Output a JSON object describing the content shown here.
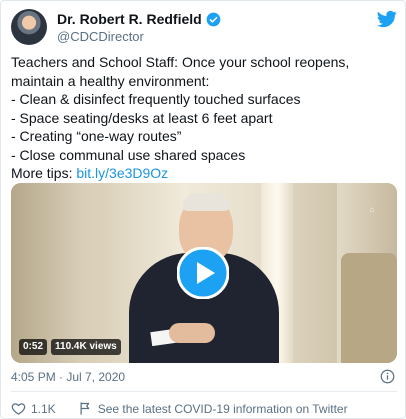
{
  "author": {
    "name": "Dr. Robert R. Redfield",
    "handle": "@CDCDirector"
  },
  "tweet": {
    "lines": [
      "Teachers and School Staff: Once your school reopens,",
      "maintain a healthy environment:",
      "- Clean & disinfect frequently touched surfaces",
      "- Space seating/desks at least 6 feet apart",
      "- Creating “one-way routes”",
      "- Close communal use shared spaces"
    ],
    "more_tips_label": "More tips:",
    "link_text": "bit.ly/3e3D9Oz"
  },
  "video": {
    "duration": "0:52",
    "views": "110.4K views"
  },
  "timestamp": "4:05 PM · Jul 7, 2020",
  "actions": {
    "likes": "1.1K",
    "covid_info": "See the latest COVID-19 information on Twitter"
  },
  "colors": {
    "link": "#1b95e0",
    "secondary_text": "#5b7083",
    "brand": "#1da1f2"
  }
}
